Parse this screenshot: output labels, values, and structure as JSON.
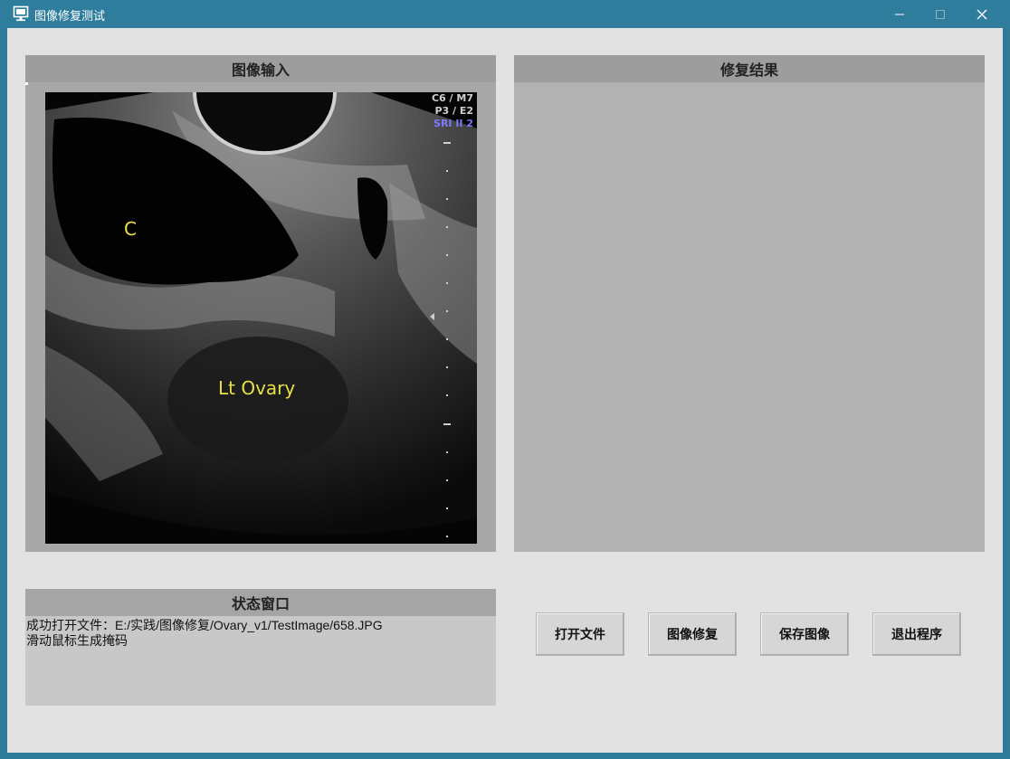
{
  "window": {
    "title": "图像修复测试",
    "icon": "monitor-icon",
    "controls": {
      "minimize": "—",
      "maximize": "☐",
      "close": "✕"
    }
  },
  "input_panel": {
    "header": "图像输入",
    "image": {
      "overlay_top_right": [
        "C6 / M7",
        "P3 / E2",
        "SRI II 2"
      ],
      "label_c": "C",
      "label_ovary": "Lt Ovary"
    }
  },
  "result_panel": {
    "header": "修复结果"
  },
  "status_panel": {
    "header": "状态窗口",
    "lines": [
      "成功打开文件：E:/实践/图像修复/Ovary_v1/TestImage/658.JPG",
      "滑动鼠标生成掩码"
    ]
  },
  "buttons": {
    "open": "打开文件",
    "repair": "图像修复",
    "save": "保存图像",
    "exit": "退出程序"
  },
  "colors": {
    "titlebar": "#2f7d9c",
    "client_bg": "#e2e2e2",
    "panel_header": "#9d9d9d",
    "panel_body": "#b2b2b2",
    "label_yellow": "#e8e04a",
    "overlay_blue": "#7b7bff"
  }
}
